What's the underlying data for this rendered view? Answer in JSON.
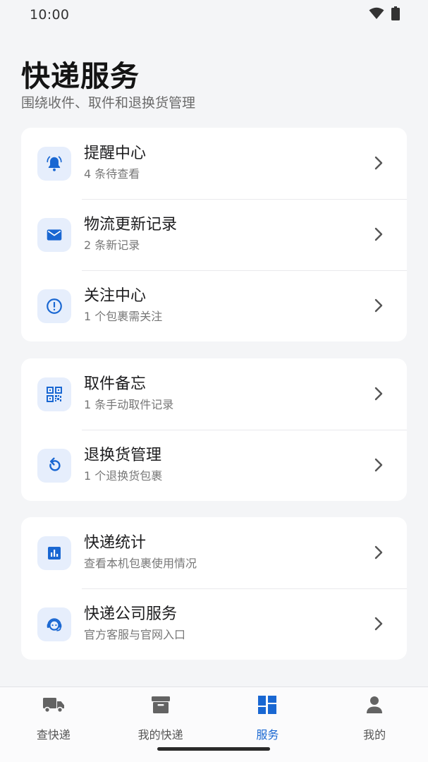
{
  "status_bar": {
    "time": "10:00"
  },
  "header": {
    "title": "快递服务",
    "subtitle": "围绕收件、取件和退换货管理"
  },
  "groups": [
    {
      "items": [
        {
          "icon": "bell-alert-icon",
          "title": "提醒中心",
          "subtitle": "4 条待查看"
        },
        {
          "icon": "mail-icon",
          "title": "物流更新记录",
          "subtitle": "2 条新记录"
        },
        {
          "icon": "alert-circle-icon",
          "title": "关注中心",
          "subtitle": "1 个包裹需关注"
        }
      ]
    },
    {
      "items": [
        {
          "icon": "qr-code-icon",
          "title": "取件备忘",
          "subtitle": "1 条手动取件记录"
        },
        {
          "icon": "refresh-icon",
          "title": "退换货管理",
          "subtitle": "1 个退换货包裹"
        }
      ]
    },
    {
      "items": [
        {
          "icon": "bar-chart-icon",
          "title": "快递统计",
          "subtitle": "查看本机包裹使用情况"
        },
        {
          "icon": "support-agent-icon",
          "title": "快递公司服务",
          "subtitle": "官方客服与官网入口"
        }
      ]
    }
  ],
  "bottom_nav": {
    "active": "服务",
    "active_color": "#1967d2",
    "items": [
      {
        "icon": "truck-icon",
        "label": "查快递"
      },
      {
        "icon": "archive-box-icon",
        "label": "我的快递"
      },
      {
        "icon": "dashboard-icon",
        "label": "服务"
      },
      {
        "icon": "person-icon",
        "label": "我的"
      }
    ]
  },
  "colors": {
    "accent": "#1967d2",
    "icon_bg": "#e6eefc",
    "background": "#f4f5f7"
  }
}
